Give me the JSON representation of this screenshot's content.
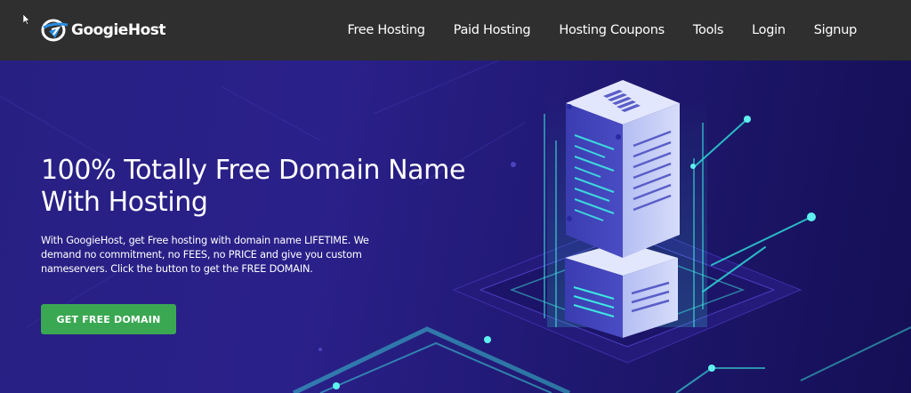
{
  "brand": {
    "name": "GoogieHost"
  },
  "nav": {
    "items": [
      {
        "label": "Free Hosting"
      },
      {
        "label": "Paid Hosting"
      },
      {
        "label": "Hosting Coupons"
      },
      {
        "label": "Tools"
      },
      {
        "label": "Login"
      },
      {
        "label": "Signup"
      }
    ]
  },
  "hero": {
    "title": "100% Totally Free Domain Name With Hosting",
    "description": "With GoogieHost, get Free hosting with domain name LIFETIME. We demand no commitment, no FEES, no PRICE and give you custom nameservers. Click the button to get the FREE DOMAIN.",
    "cta_label": "GET FREE DOMAIN"
  },
  "colors": {
    "navbar_bg": "#2f2f2f",
    "hero_bg": "#272082",
    "cta_bg": "#3aa852",
    "accent_cyan": "#3de8e0"
  },
  "icons": [
    "logo-mark-icon",
    "mouse-cursor-icon",
    "server-illustration"
  ]
}
